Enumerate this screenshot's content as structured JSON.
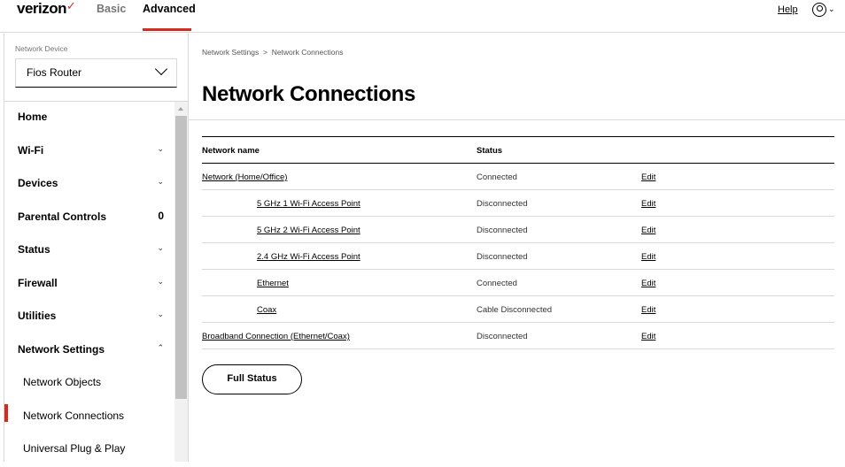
{
  "header": {
    "logo": "verizon",
    "tabs": [
      "Basic",
      "Advanced"
    ],
    "active_tab": "Advanced",
    "help": "Help",
    "accent": "#d52b1e"
  },
  "sidebar": {
    "device_label": "Network Device",
    "device_value": "Fios Router",
    "items": [
      {
        "label": "Home",
        "suffix": ""
      },
      {
        "label": "Wi-Fi",
        "suffix": "⌄"
      },
      {
        "label": "Devices",
        "suffix": "⌄"
      },
      {
        "label": "Parental Controls",
        "suffix": "0"
      },
      {
        "label": "Status",
        "suffix": "⌄"
      },
      {
        "label": "Firewall",
        "suffix": "⌄"
      },
      {
        "label": "Utilities",
        "suffix": "⌄"
      },
      {
        "label": "Network Settings",
        "suffix": "⌃"
      },
      {
        "label": "Network Objects",
        "suffix": ""
      },
      {
        "label": "Network Connections",
        "suffix": ""
      },
      {
        "label": "Universal Plug & Play",
        "suffix": ""
      }
    ]
  },
  "breadcrumb": [
    "Network Settings",
    ">",
    "Network Connections"
  ],
  "title": "Network Connections",
  "table": {
    "headers": [
      "Network name",
      "Status"
    ],
    "rows": [
      {
        "name": "Network (Home/Office)",
        "status": "Connected",
        "action": "Edit"
      },
      {
        "name": "5 GHz 1 Wi-Fi Access Point",
        "status": "Disconnected",
        "action": "Edit"
      },
      {
        "name": "5 GHz 2 Wi-Fi Access Point",
        "status": "Disconnected",
        "action": "Edit"
      },
      {
        "name": "2.4 GHz Wi-Fi Access Point",
        "status": "Disconnected",
        "action": "Edit"
      },
      {
        "name": "Ethernet",
        "status": "Connected",
        "action": "Edit"
      },
      {
        "name": "Coax",
        "status": "Cable Disconnected",
        "action": "Edit"
      },
      {
        "name": "Broadband Connection (Ethernet/Coax)",
        "status": "Disconnected",
        "action": "Edit"
      }
    ]
  },
  "full_status": "Full Status"
}
